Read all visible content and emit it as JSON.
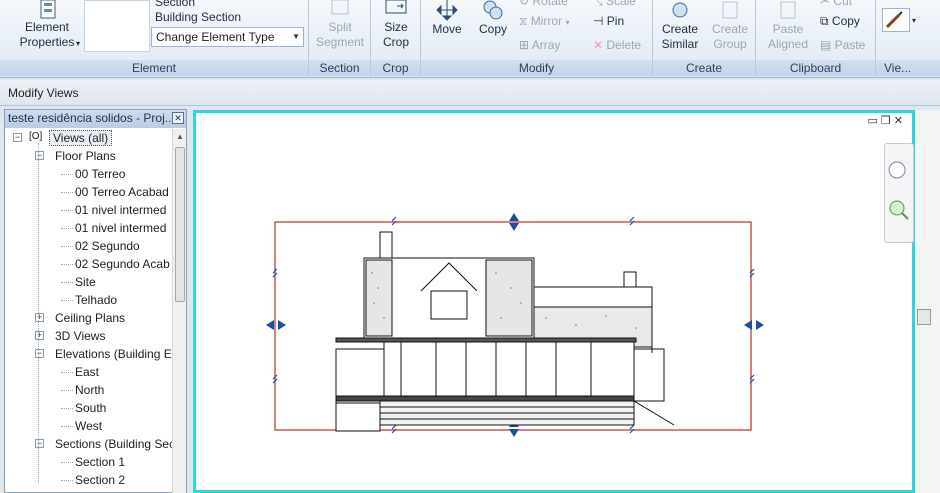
{
  "ribbon": {
    "element_panel": {
      "title": "Element",
      "properties_label_line1": "Element",
      "properties_label_line2": "Properties",
      "type_line1": "Section",
      "type_line2": "Building Section",
      "combo_value": "Change Element Type"
    },
    "section_panel": {
      "title": "Section",
      "split_line1": "Split",
      "split_line2": "Segment"
    },
    "crop_panel": {
      "title": "Crop",
      "size_line1": "Size",
      "size_line2": "Crop"
    },
    "modify_panel": {
      "title": "Modify",
      "move": "Move",
      "copy": "Copy",
      "rotate": "Rotate",
      "scale": "Scale",
      "mirror": "Mirror",
      "pin": "Pin",
      "array": "Array",
      "delete": "Delete"
    },
    "create_panel": {
      "title": "Create",
      "similar_line1": "Create",
      "similar_line2": "Similar",
      "group_line1": "Create",
      "group_line2": "Group"
    },
    "clipboard_panel": {
      "title": "Clipboard",
      "paste_line1": "Paste",
      "paste_line2": "Aligned",
      "cut": "Cut",
      "copy": "Copy",
      "paste": "Paste"
    },
    "view_panel": {
      "title": "Vie..."
    }
  },
  "options_bar": {
    "label": "Modify Views"
  },
  "browser": {
    "title": "teste residência solidos - Proj...",
    "tree": [
      {
        "label": "Views (all)",
        "level": 0,
        "toggle": "-"
      },
      {
        "label": "Floor Plans",
        "level": 1,
        "toggle": "-"
      },
      {
        "label": "00 Terreo",
        "level": 2
      },
      {
        "label": "00 Terreo Acabad",
        "level": 2
      },
      {
        "label": "01 nivel intermed",
        "level": 2
      },
      {
        "label": "01 nivel intermed",
        "level": 2
      },
      {
        "label": "02 Segundo",
        "level": 2
      },
      {
        "label": "02 Segundo Acab",
        "level": 2
      },
      {
        "label": "Site",
        "level": 2
      },
      {
        "label": "Telhado",
        "level": 2
      },
      {
        "label": "Ceiling Plans",
        "level": 1,
        "toggle": "+"
      },
      {
        "label": "3D Views",
        "level": 1,
        "toggle": "+"
      },
      {
        "label": "Elevations (Building E",
        "level": 1,
        "toggle": "-"
      },
      {
        "label": "East",
        "level": 2
      },
      {
        "label": "North",
        "level": 2
      },
      {
        "label": "South",
        "level": 2
      },
      {
        "label": "West",
        "level": 2
      },
      {
        "label": "Sections (Building Sec",
        "level": 1,
        "toggle": "-"
      },
      {
        "label": "Section 1",
        "level": 2
      },
      {
        "label": "Section 2",
        "level": 2
      }
    ]
  },
  "view": {
    "crop_color": "#b03030",
    "border_color": "#2fd6d6"
  }
}
